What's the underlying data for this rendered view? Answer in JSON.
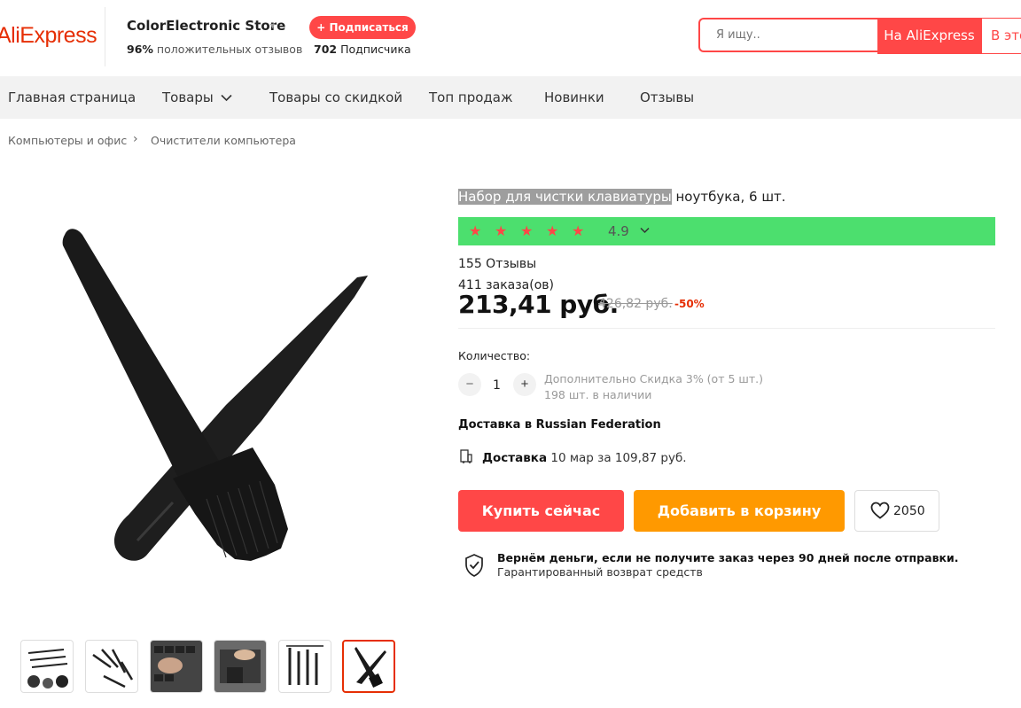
{
  "header": {
    "logo_text": "AliExpress",
    "store_name": "ColorElectronic Store",
    "store_caret": "▼",
    "positive_pct": "96%",
    "positive_text": "положительных отзывов",
    "subscribe_label": "+ Подписаться",
    "subscribers_count": "702",
    "subscribers_text": "Подписчика",
    "search_placeholder": "Я ищу..",
    "search_btn_aliexpress": "На AliExpress",
    "search_btn_store": "В этом"
  },
  "nav": {
    "items": [
      "Главная страница",
      "Товары",
      "Товары со скидкой",
      "Топ продаж",
      "Новинки",
      "Отзывы"
    ]
  },
  "breadcrumb": {
    "items": [
      "Компьютеры и офис",
      "Очистители компьютера"
    ],
    "separator": "›"
  },
  "product": {
    "title_highlighted": "Набор для чистки клавиатуры",
    "title_rest": " ноутбука, 6 шт.",
    "rating": "4.9",
    "stars": 5,
    "reviews": "155 Отзывы",
    "orders": "411 заказа(ов)",
    "price": "213,41 руб.",
    "old_price": "426,82 руб.",
    "discount": "-50%",
    "quantity_label": "Количество:",
    "quantity_value": "1",
    "qty_minus": "−",
    "qty_plus": "+",
    "extra_discount": "Дополнительно Скидка 3% (от 5 шт.)",
    "stock": "198 шт. в наличии",
    "shipping_title": "Доставка в Russian Federation",
    "shipping_label": "Доставка",
    "shipping_detail": " 10 мар за 109,87 руб.",
    "buy_now": "Купить сейчас",
    "add_to_cart": "Добавить в корзину",
    "wishlist_count": "2050",
    "guarantee_title": "Вернём деньги, если не получите заказ через 90 дней после отправки.",
    "guarantee_sub": "Гарантированный возврат средств"
  },
  "colors": {
    "accent": "#ff4747",
    "brand": "#e62e04",
    "cart": "#ff9900",
    "rating_bg": "#4cdf6e"
  }
}
